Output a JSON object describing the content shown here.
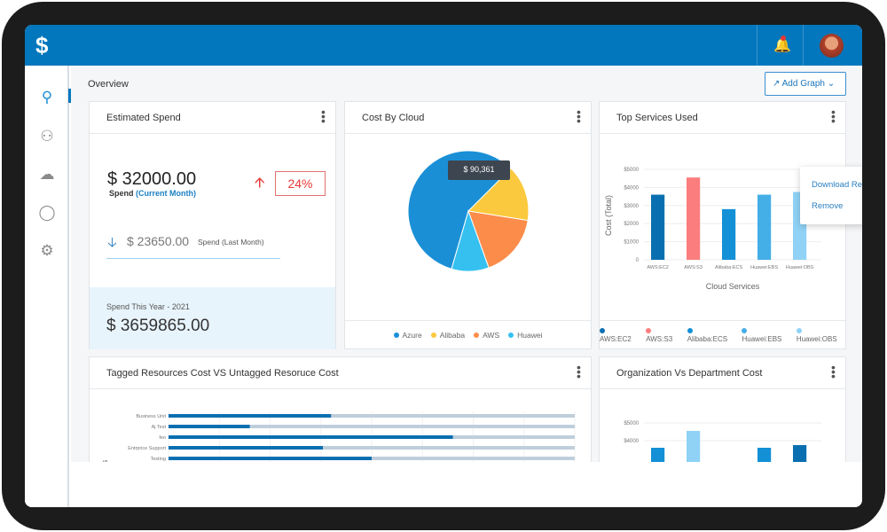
{
  "header": {
    "logo": "$",
    "notification_icon": "bell-icon",
    "notification_color": "#e53935",
    "brand_color": "#0277bd"
  },
  "sidebar": {
    "items": [
      {
        "icon": "lightbulb-icon",
        "active": true
      },
      {
        "icon": "users-icon"
      },
      {
        "icon": "cloud-user-icon"
      },
      {
        "icon": "cost-settings-icon"
      },
      {
        "icon": "gear-icon"
      }
    ]
  },
  "page": {
    "title": "Overview",
    "add_graph": "Add Graph"
  },
  "estimated_spend": {
    "title": "Estimated Spend",
    "current": "$ 32000.00",
    "current_label": "Spend",
    "current_period": "(Current Month)",
    "change": "24%",
    "last": "$ 23650.00",
    "last_label": "Spend (Last Month)",
    "year_label": "Spend This Year - 2021",
    "year_value": "$ 3659865.00"
  },
  "cost_by_cloud": {
    "title": "Cost By Cloud",
    "tooltip": "$ 90,361"
  },
  "top_services": {
    "title": "Top Services Used",
    "menu": [
      "Download Report",
      "Remove"
    ]
  },
  "tagged": {
    "title": "Tagged Resources Cost VS Untagged Resoruce Cost"
  },
  "org": {
    "title": "Organization Vs Department Cost"
  },
  "chart_data": [
    {
      "type": "pie",
      "series": [
        {
          "name": "Azure",
          "value": 58,
          "color": "#1a8fd6"
        },
        {
          "name": "Alibaba",
          "value": 15,
          "color": "#fbc93d"
        },
        {
          "name": "AWS",
          "value": 17,
          "color": "#fb8c4a"
        },
        {
          "name": "Huawei",
          "value": 10,
          "color": "#35c0f0"
        }
      ]
    },
    {
      "type": "bar",
      "xlabel": "Cloud Services",
      "ylabel": "Cost (Total)",
      "ylim": [
        0,
        5000
      ],
      "yticks": [
        "0",
        "$1000",
        "$2000",
        "$3000",
        "$4000",
        "$5000"
      ],
      "categories": [
        "AWS:EC2",
        "AWS:S3",
        "Alibaba:ECS",
        "Huawei:EBS",
        "Huawei:OBS"
      ],
      "values": [
        3600,
        4550,
        2800,
        3600,
        3750
      ],
      "colors": [
        "#0a6fb0",
        "#fb7d7d",
        "#1390d6",
        "#44aee6",
        "#8fd2f6"
      ]
    },
    {
      "type": "bar",
      "orientation": "horizontal",
      "ylabel": "vices",
      "categories": [
        "Business Unit",
        "Aj Test",
        "feo",
        "Entrprice Support",
        "Testing"
      ],
      "values_percent": [
        40,
        20,
        70,
        38,
        50
      ],
      "colors": [
        "#0a6fb0",
        "#bfcedb"
      ]
    },
    {
      "type": "bar",
      "yticks": [
        "$4000",
        "$5000"
      ],
      "ylim": [
        0,
        5000
      ],
      "values": [
        3600,
        4550,
        0,
        3600,
        3750
      ],
      "colors": [
        "#1390d6",
        "#8fd2f6",
        "#1390d6",
        "#1390d6",
        "#0a6fb0"
      ]
    }
  ]
}
